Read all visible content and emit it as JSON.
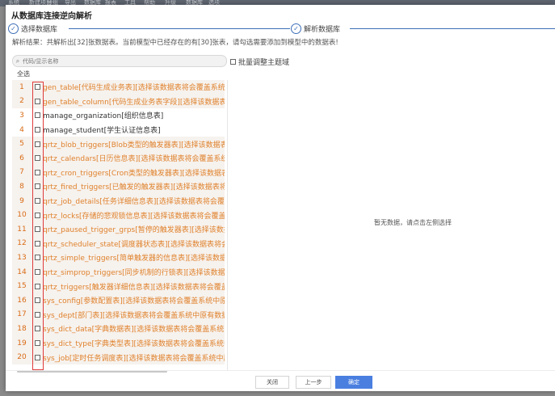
{
  "background_menu": [
    "系统",
    "新建项目",
    "分组",
    "导出",
    "数据库",
    "报表",
    "工具",
    "帮助",
    "升级",
    "数据库",
    "选项"
  ],
  "dialog": {
    "title": "从数据库连接逆向解析",
    "steps": [
      {
        "label": "选择数据库"
      },
      {
        "label": "解析数据库"
      }
    ],
    "summary": "解析结果：共解析出[32]张数据表。当前模型中已经存在的有[30]张表，请勾选需要添加到模型中的数据表!",
    "search_placeholder": "代码/显示名称",
    "batch_label": "批量调整主题域",
    "select_all_label": "全选",
    "empty_text": "暂无数据，请点击左侧选择",
    "buttons": {
      "close": "关闭",
      "prev": "上一步",
      "confirm": "确定"
    }
  },
  "tables": [
    {
      "num": "1",
      "label": "gen_table[代码生成业务表][选择该数据表将会覆盖系统中原有数据表]",
      "exists": true
    },
    {
      "num": "2",
      "label": "gen_table_column[代码生成业务表字段][选择该数据表将会覆盖系统中原有数据表]",
      "exists": true
    },
    {
      "num": "3",
      "label": "manage_organization[组织信息表]",
      "exists": false
    },
    {
      "num": "4",
      "label": "manage_student[学生认证信息表]",
      "exists": false
    },
    {
      "num": "5",
      "label": "qrtz_blob_triggers[Blob类型的触发器表][选择该数据表将会覆盖系统中原有数据表]",
      "exists": true
    },
    {
      "num": "6",
      "label": "qrtz_calendars[日历信息表][选择该数据表将会覆盖系统中原有数据表]",
      "exists": true
    },
    {
      "num": "7",
      "label": "qrtz_cron_triggers[Cron类型的触发器表][选择该数据表将会覆盖系统中原有数据表]",
      "exists": true
    },
    {
      "num": "8",
      "label": "qrtz_fired_triggers[已触发的触发器表][选择该数据表将会覆盖系统中原有数据表]",
      "exists": true
    },
    {
      "num": "9",
      "label": "qrtz_job_details[任务详细信息表][选择该数据表将会覆盖系统中原有数据表]",
      "exists": true
    },
    {
      "num": "10",
      "label": "qrtz_locks[存储的悲观锁信息表][选择该数据表将会覆盖系统中原有数据表]",
      "exists": true
    },
    {
      "num": "11",
      "label": "qrtz_paused_trigger_grps[暂停的触发器表][选择该数据表将会覆盖系统中原有数据表]",
      "exists": true
    },
    {
      "num": "12",
      "label": "qrtz_scheduler_state[调度器状态表][选择该数据表将会覆盖系统中原有数据表]",
      "exists": true
    },
    {
      "num": "13",
      "label": "qrtz_simple_triggers[简单触发器的信息表][选择该数据表将会覆盖系统中原有数据表]",
      "exists": true
    },
    {
      "num": "14",
      "label": "qrtz_simprop_triggers[同步机制的行锁表][选择该数据表将会覆盖系统中原有数据表]",
      "exists": true
    },
    {
      "num": "15",
      "label": "qrtz_triggers[触发器详细信息表][选择该数据表将会覆盖系统中原有数据表]",
      "exists": true
    },
    {
      "num": "16",
      "label": "sys_config[参数配置表][选择该数据表将会覆盖系统中原有数据表]",
      "exists": true
    },
    {
      "num": "17",
      "label": "sys_dept[部门表][选择该数据表将会覆盖系统中原有数据表]",
      "exists": true
    },
    {
      "num": "18",
      "label": "sys_dict_data[字典数据表][选择该数据表将会覆盖系统中原有数据表]",
      "exists": true
    },
    {
      "num": "19",
      "label": "sys_dict_type[字典类型表][选择该数据表将会覆盖系统中原有数据表]",
      "exists": true
    },
    {
      "num": "20",
      "label": "sys_job[定时任务调度表][选择该数据表将会覆盖系统中原有数据表]",
      "exists": true
    }
  ],
  "colors": {
    "accent": "#4a7fe0",
    "existing_table": "#e0822d",
    "highlight": "#e03b3b"
  }
}
